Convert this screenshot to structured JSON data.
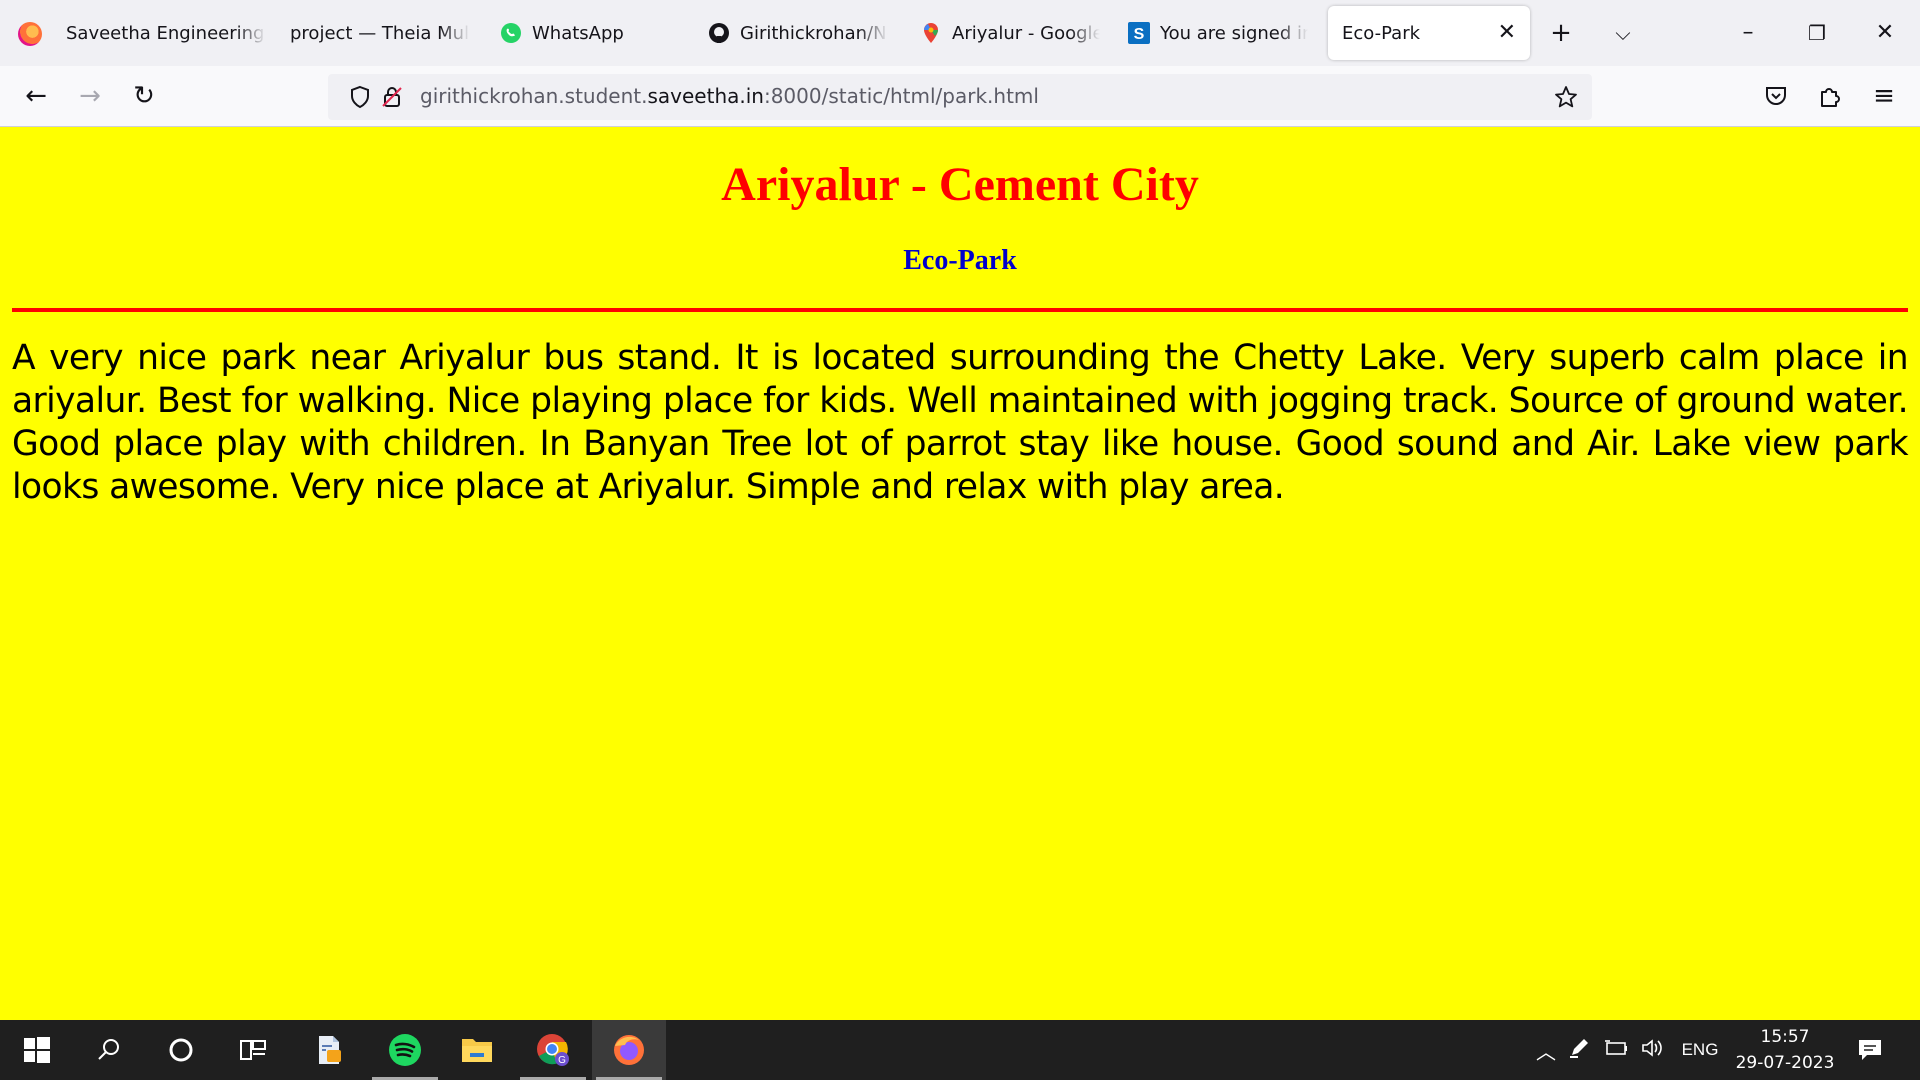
{
  "browser": {
    "tabs": [
      {
        "label": "Saveetha Engineering",
        "icon": "saveetha-favicon"
      },
      {
        "label": "project — Theia Multi-",
        "icon": "theia-favicon"
      },
      {
        "label": "WhatsApp",
        "icon": "whatsapp-icon"
      },
      {
        "label": "Girithickrohan/Ne",
        "icon": "github-icon"
      },
      {
        "label": "Ariyalur - Google M",
        "icon": "google-maps-icon"
      },
      {
        "label": "You are signed in a",
        "icon": "s-favicon"
      },
      {
        "label": "Eco-Park",
        "icon": "page-favicon",
        "active": true
      }
    ],
    "url": {
      "prefix": "girithickrohan.student.",
      "domain": "saveetha.in",
      "suffix": ":8000/static/html/park.html"
    }
  },
  "page": {
    "title": "Ariyalur - Cement City",
    "subtitle": "Eco-Park",
    "body": "A very nice park near Ariyalur bus stand. It is located surrounding the Chetty Lake. Very superb calm place in ariyalur. Best for walking. Nice playing place for kids. Well maintained with jogging track. Source of ground water. Good place play with children. In Banyan Tree lot of parrot stay like house. Good sound and Air. Lake view park looks awesome. Very nice place at Ariyalur. Simple and relax with play area.",
    "colors": {
      "background": "#ffff00",
      "title": "#ff0000",
      "subtitle": "#0000cc",
      "rule": "#ff0000"
    }
  },
  "taskbar": {
    "apps": [
      "windows-start",
      "search",
      "cortana",
      "task-view",
      "pdf-editor",
      "spotify",
      "file-explorer",
      "chrome",
      "firefox"
    ],
    "tray": {
      "language": "ENG",
      "time": "15:57",
      "date": "29-07-2023"
    }
  }
}
